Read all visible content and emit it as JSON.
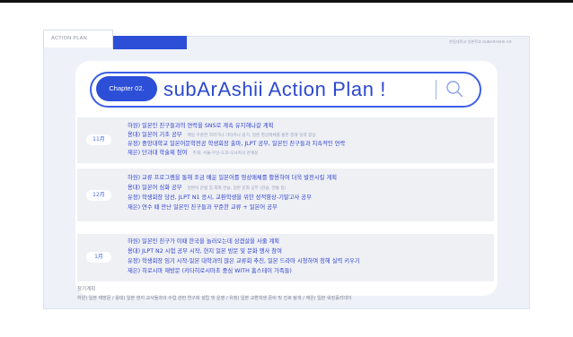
{
  "tab": {
    "label": "ACTION PLAN"
  },
  "topright_text": "한림대학교 일본학과 SUBARASHII A조",
  "header": {
    "chapter": "Chapter 02.",
    "title": "subArAshii Action Plan !",
    "divider": "|",
    "search_icon": "search-icon"
  },
  "months": [
    {
      "label": "11月",
      "rows": [
        {
          "text": "하원) 일본인 친구들과의 연락을 SNS로 계속 유지해나갈 계획",
          "note": ""
        },
        {
          "text": "용대) 일본어 기초 공부",
          "note": "매일 꾸준한 히라가나 가타카나 읽기, 일본 영상매체를 통한 청해 실력 향상"
        },
        {
          "text": "유정) 중앙대학교 일본어문학전공 학생회장 출마, JLPT 공부, 일본인 친구들과 지속적인 연락",
          "note": ""
        },
        {
          "text": "재은) 단과대 학술제 참여",
          "note": "주제: 서울-부산-도쿄-오사카의 관계성"
        }
      ]
    },
    {
      "label": "12月",
      "rows": [
        {
          "text": "하원) 교류 프로그램을 통해 조금 배운 일본어를 영상매체를 활용하여 더욱 발전시킬 계획",
          "note": ""
        },
        {
          "text": "용대) 일본어 심화 공부",
          "note": "일본어 문법 및 회화 연습, 일본 문화 공부 (관습, 전통 등)"
        },
        {
          "text": "유정) 학생회장 당선, JLPT N1 응시, 교환학생을 위한 성적향상-기말고사 공부",
          "note": ""
        },
        {
          "text": "재은) 연수 때 만난 일본인 친구들과 꾸준한 교류 + 일본어 공부",
          "note": ""
        }
      ]
    },
    {
      "label": "1月",
      "rows": [
        {
          "text": "하원) 일본인 친구가 이때 한국을 놀러오는데 삼겹살을 사줄 계획",
          "note": ""
        },
        {
          "text": "용대) JLPT N2 시험 공부 시작, 현지 일본 방문 및 문화 행사 참여",
          "note": ""
        },
        {
          "text": "유정) 학생회장 임기 시작-일본 대학과의 많은 교류회 추진, 일본 드라마 시청하며 청해 실력 키우기",
          "note": ""
        },
        {
          "text": "재은) 히로시마 재방문 (키타히로시마초 중심 WITH 홈스테이 가족들)",
          "note": ""
        }
      ]
    }
  ],
  "long_term": {
    "title": "장기계획",
    "text": "하원) 일본 재방문 / 용대) 일본 현지 교사들과의 수업 관련 연구회 설립 및 운영 / 유정) 일본 교환학생 준비 및 진로 탐색 / 재은) 일본 워킹홀리데이"
  }
}
